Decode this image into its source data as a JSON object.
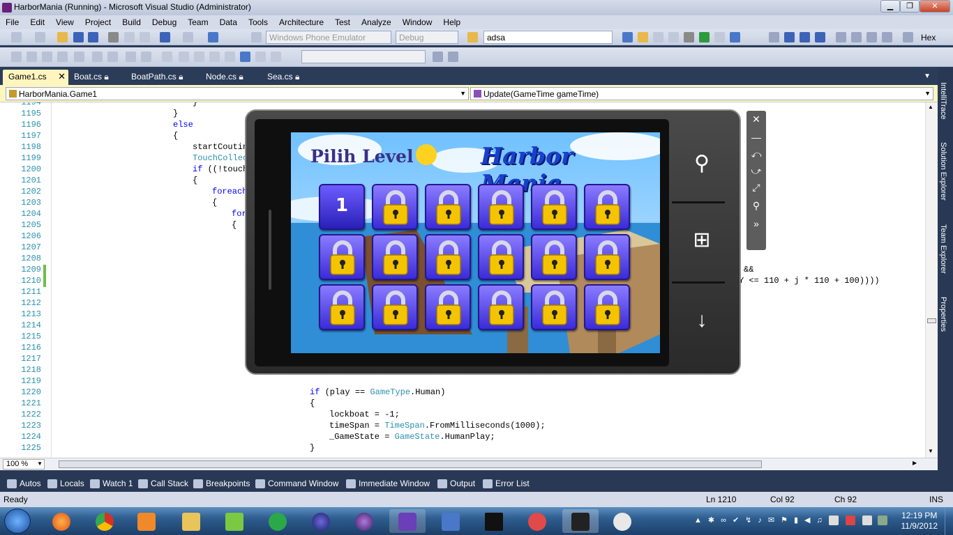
{
  "window": {
    "title": "HarborMania (Running) - Microsoft Visual Studio (Administrator)",
    "minimize": "▁",
    "restore": "❐",
    "close": "✕"
  },
  "menu": [
    "File",
    "Edit",
    "View",
    "Project",
    "Build",
    "Debug",
    "Team",
    "Data",
    "Tools",
    "Architecture",
    "Test",
    "Analyze",
    "Window",
    "Help"
  ],
  "toolbar": {
    "target": "Windows Phone Emulator",
    "config": "Debug",
    "find_value": "adsa",
    "hex_label": "Hex"
  },
  "tabs": [
    {
      "label": "Game1.cs",
      "active": true
    },
    {
      "label": "Boat.cs",
      "active": false
    },
    {
      "label": "BoatPath.cs",
      "active": false
    },
    {
      "label": "Node.cs",
      "active": false
    },
    {
      "label": "Sea.cs",
      "active": false
    }
  ],
  "navbar": {
    "type": "HarborMania.Game1",
    "member": "Update(GameTime gameTime)"
  },
  "editor": {
    "line_numbers": [
      "1194",
      "1195",
      "1196",
      "1197",
      "1198",
      "1199",
      "1200",
      "1201",
      "1202",
      "1203",
      "1204",
      "1205",
      "1206",
      "1207",
      "1208",
      "1209",
      "1210",
      "1211",
      "1212",
      "1213",
      "1214",
      "1215",
      "1216",
      "1217",
      "1218",
      "1219",
      "1220",
      "1221",
      "1222",
      "1223",
      "1224",
      "1225"
    ],
    "lines": {
      "l1194": "}",
      "l1195": "}",
      "l1196": "else",
      "l1197": "{",
      "l1198": "startCoutin",
      "l1199": "TouchCollec",
      "l1200a": "if",
      "l1200b": " ((!touch",
      "l1201": "{",
      "l1202": "foreach",
      "l1203": "{",
      "l1204": "for",
      "l1205": "{",
      "l1209": "&&",
      "l1210": "Y <= 110 + j * 110 + 100))))",
      "l1220a": "if",
      "l1220b": " (play == ",
      "l1220c": "GameType",
      "l1220d": ".Human)",
      "l1221": "{",
      "l1222": "lockboat = -1;",
      "l1223a": "timeSpan = ",
      "l1223b": "TimeSpan",
      "l1223c": ".FromMilliseconds(1000);",
      "l1224a": "_GameState = ",
      "l1224b": "GameState",
      "l1224c": ".HumanPlay;",
      "l1225": "}"
    },
    "zoom": "100 %"
  },
  "game": {
    "title_left": "Pilih Level",
    "title_right": "Harbor Mania",
    "unlocked_level": "1",
    "rows": 3,
    "cols": 6
  },
  "tool_windows": [
    "Autos",
    "Locals",
    "Watch 1",
    "Call Stack",
    "Breakpoints",
    "Command Window",
    "Immediate Window",
    "Output",
    "Error List"
  ],
  "side_tabs": [
    "IntelliTrace",
    "Solution Explorer",
    "Team Explorer",
    "Properties"
  ],
  "status": {
    "state": "Ready",
    "ln": "Ln 1210",
    "col": "Col 92",
    "ch": "Ch 92",
    "ins": "INS"
  },
  "clock": {
    "time": "12:19 PM",
    "date": "11/9/2012"
  },
  "colors": {
    "accent": "#293955",
    "tab_active": "#fff6bf",
    "tile": "#3a2bd8",
    "lock": "#f5c400"
  }
}
